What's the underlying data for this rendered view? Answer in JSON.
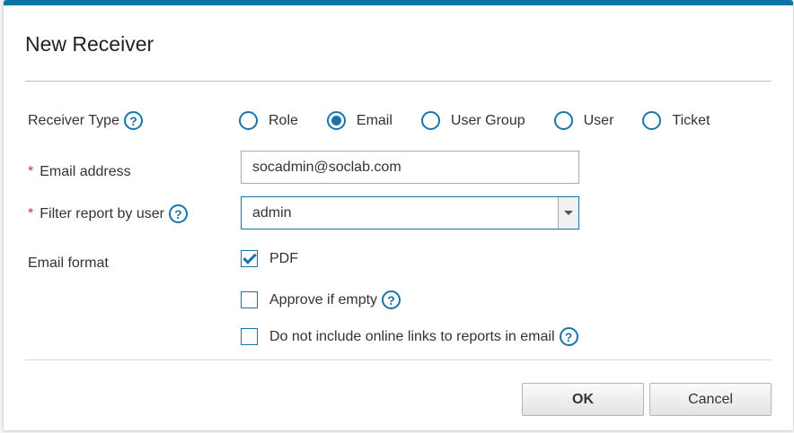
{
  "dialog": {
    "title": "New Receiver"
  },
  "receiver_type": {
    "label": "Receiver Type",
    "options": [
      {
        "label": "Role",
        "checked": false
      },
      {
        "label": "Email",
        "checked": true
      },
      {
        "label": "User Group",
        "checked": false
      },
      {
        "label": "User",
        "checked": false
      },
      {
        "label": "Ticket",
        "checked": false
      }
    ]
  },
  "email_address": {
    "label": "Email address",
    "required_mark": "*",
    "value": "socadmin@soclab.com"
  },
  "filter_user": {
    "label": "Filter report by user",
    "required_mark": "*",
    "value": "admin"
  },
  "email_format": {
    "label": "Email format",
    "pdf_label": "PDF",
    "pdf_checked": true
  },
  "approve_if_empty": {
    "label": "Approve if empty",
    "checked": false
  },
  "no_online_links": {
    "label": "Do not include online links to reports in email",
    "checked": false
  },
  "help_glyph": "?",
  "buttons": {
    "ok": "OK",
    "cancel": "Cancel"
  },
  "colors": {
    "accent": "#0a76a8",
    "required": "#c0392b"
  }
}
